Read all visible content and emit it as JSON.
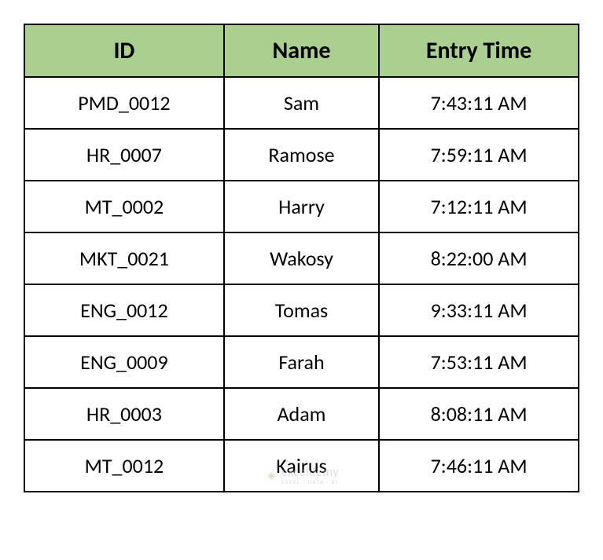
{
  "table": {
    "headers": {
      "id": "ID",
      "name": "Name",
      "entry_time": "Entry Time"
    },
    "rows": [
      {
        "id": "PMD_0012",
        "name": "Sam",
        "entry_time": "7:43:11 AM"
      },
      {
        "id": "HR_0007",
        "name": "Ramose",
        "entry_time": "7:59:11 AM"
      },
      {
        "id": "MT_0002",
        "name": "Harry",
        "entry_time": "7:12:11 AM"
      },
      {
        "id": "MKT_0021",
        "name": "Wakosy",
        "entry_time": "8:22:00 AM"
      },
      {
        "id": "ENG_0012",
        "name": "Tomas",
        "entry_time": "9:33:11 AM"
      },
      {
        "id": "ENG_0009",
        "name": "Farah",
        "entry_time": "7:53:11 AM"
      },
      {
        "id": "HR_0003",
        "name": "Adam",
        "entry_time": "8:08:11 AM"
      },
      {
        "id": "MT_0012",
        "name": "Kairus",
        "entry_time": "7:46:11 AM"
      }
    ]
  },
  "watermark": {
    "main": "exceldemy",
    "sub": "EXCEL · DATA · BI"
  }
}
